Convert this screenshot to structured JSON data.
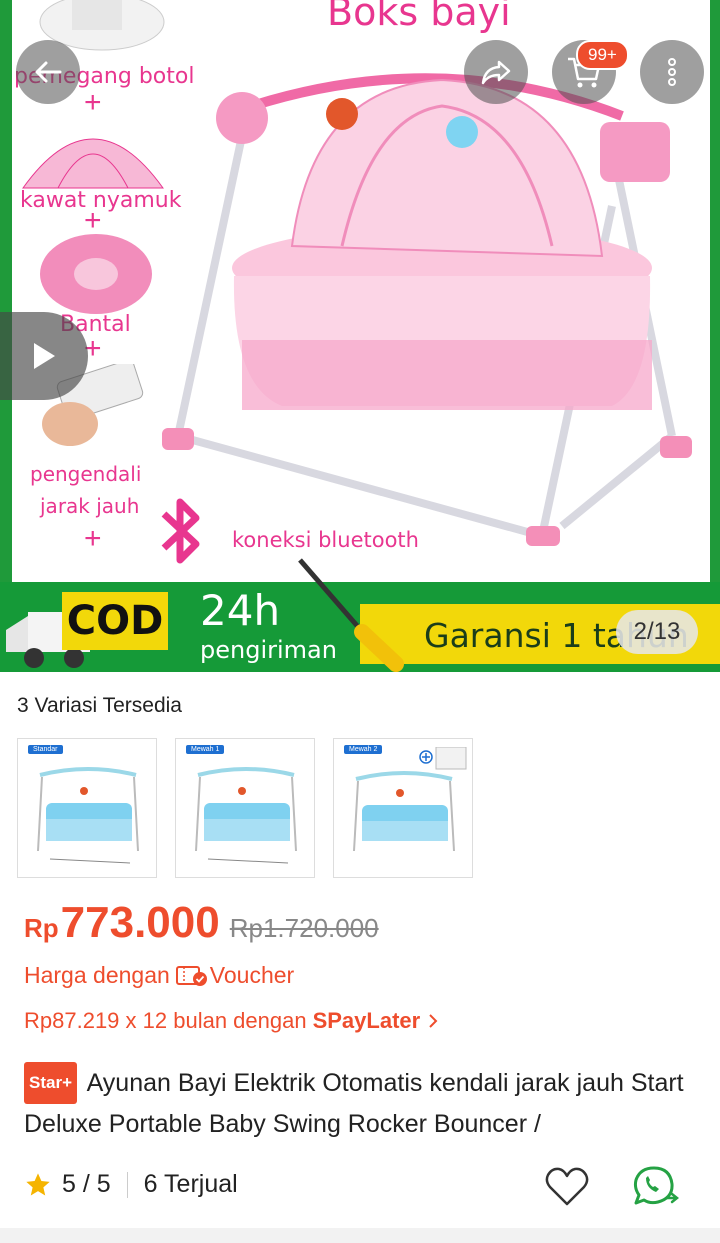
{
  "hero": {
    "title": "Boks bayi",
    "labels": {
      "botol": "pemegang botol",
      "nyamuk": "kawat nyamuk",
      "bantal": "Bantal",
      "remote_1": "pengendali",
      "remote_2": "jarak jauh",
      "bluetooth": "koneksi bluetooth"
    },
    "banner": {
      "cod": "COD",
      "hours": "24h",
      "shipping": "pengiriman",
      "warranty": "Garansi 1 tahun"
    },
    "counter": "2/13",
    "cart_badge": "99+"
  },
  "variants": {
    "label": "3 Variasi Tersedia",
    "items": [
      {
        "tag": "Standar"
      },
      {
        "tag": "Mewah 1"
      },
      {
        "tag": "Mewah 2"
      }
    ]
  },
  "price": {
    "currency": "Rp",
    "value": "773.000",
    "original": "Rp1.720.000",
    "voucher_prefix": "Harga dengan",
    "voucher_label": "Voucher",
    "installment_text": "Rp87.219 x 12 bulan dengan",
    "installment_brand": "SPayLater"
  },
  "product": {
    "badge": "Star+",
    "title": "Ayunan Bayi Elektrik Otomatis kendali jarak jauh Start Deluxe Portable Baby Swing Rocker Bouncer /"
  },
  "stats": {
    "rating": "5 / 5",
    "sold": "6 Terjual"
  },
  "colors": {
    "accent": "#ee4d2d",
    "pink": "#e8368f",
    "whatsapp": "#25a244"
  }
}
